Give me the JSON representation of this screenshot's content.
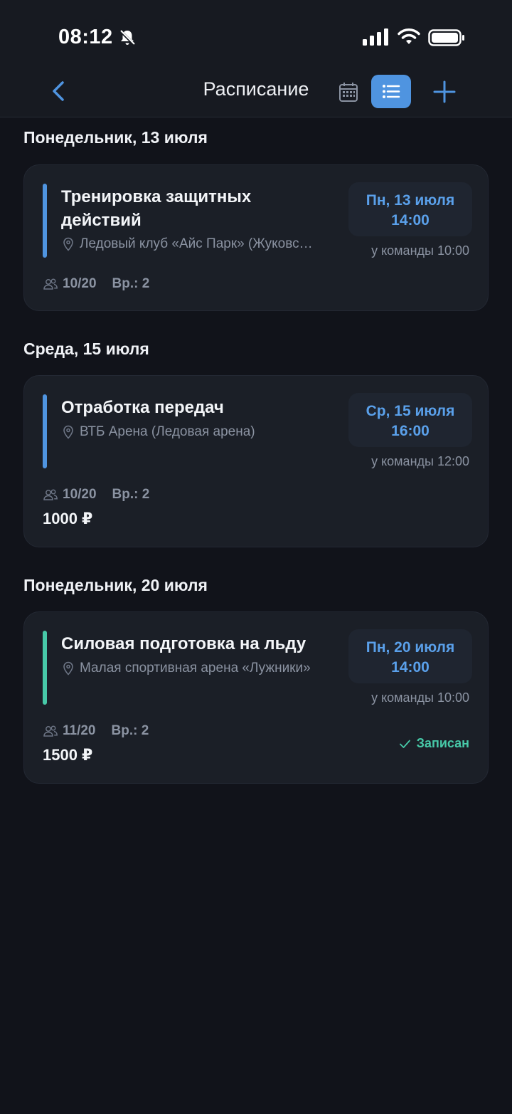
{
  "status_bar": {
    "time": "08:12"
  },
  "nav": {
    "title": "Расписание"
  },
  "colors": {
    "accent": "#4f94e0",
    "enrolled": "#47c9a8",
    "background": "#11131a",
    "card": "#1b1f27"
  },
  "days": [
    {
      "header": "Понедельник, 13 июля",
      "event": {
        "title": "Тренировка защитных действий",
        "place": "Ледовый клуб «Айс Парк» (Жуковс…",
        "date": "Пн, 13 июля",
        "time": "14:00",
        "meet": "у команды 10:00",
        "participants": "10/20",
        "goalies": "Вр.: 2",
        "bar_color": "blue"
      }
    },
    {
      "header": "Среда, 15 июля",
      "event": {
        "title": "Отработка передач",
        "place": "ВТБ Арена (Ледовая арена)",
        "date": "Ср, 15 июля",
        "time": "16:00",
        "meet": "у команды 12:00",
        "participants": "10/20",
        "goalies": "Вр.: 2",
        "price": "1000 ₽",
        "bar_color": "blue"
      }
    },
    {
      "header": "Понедельник, 20 июля",
      "event": {
        "title": "Силовая подготовка на льду",
        "place": "Малая спортивная арена «Лужники»",
        "date": "Пн, 20 июля",
        "time": "14:00",
        "meet": "у команды 10:00",
        "participants": "11/20",
        "goalies": "Вр.: 2",
        "price": "1500 ₽",
        "status": "Записан",
        "bar_color": "teal"
      }
    }
  ],
  "icons": {
    "back": "chevron-left-icon",
    "calendar": "calendar-icon",
    "list": "list-icon",
    "add": "plus-icon",
    "location": "location-pin-icon",
    "people": "people-icon",
    "check": "check-icon"
  }
}
